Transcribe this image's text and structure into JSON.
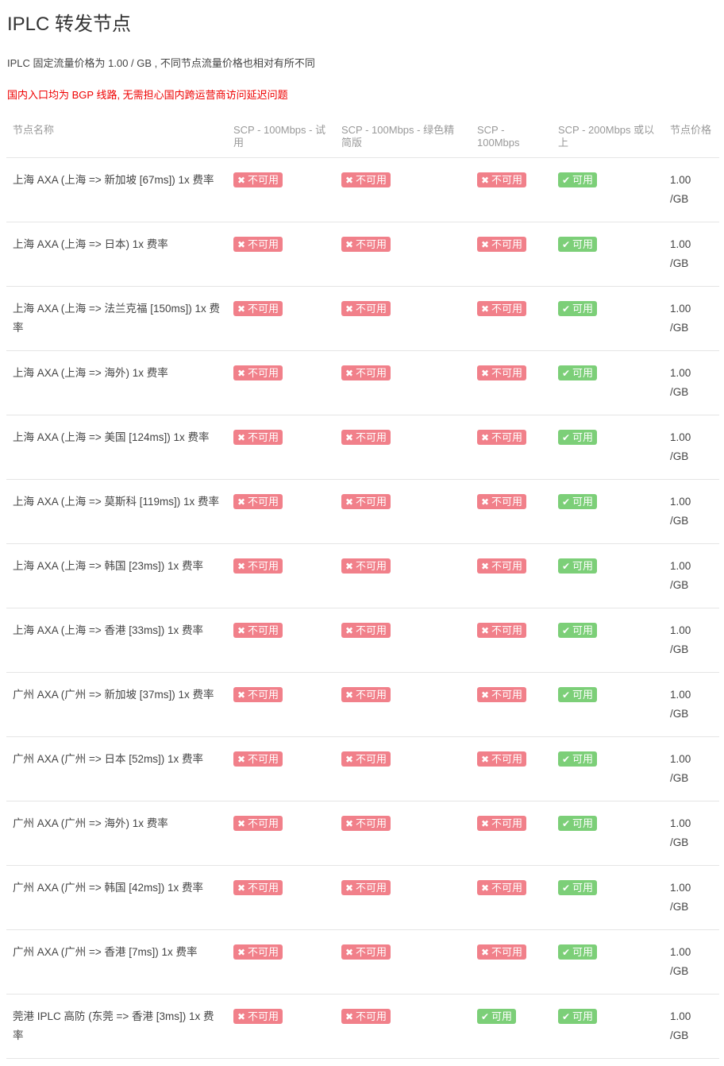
{
  "title": "IPLC 转发节点",
  "description": "IPLC 固定流量价格为 1.00 / GB , 不同节点流量价格也相对有所不同",
  "notice": "国内入口均为 BGP 线路, 无需担心国内跨运营商访问延迟问题",
  "colors": {
    "unavailable": "#f1808a",
    "available": "#7ccf78",
    "notice": "#ee0000"
  },
  "icons": {
    "unavailable": "close-icon",
    "available": "check-icon"
  },
  "status_labels": {
    "no": "不可用",
    "yes": "可用"
  },
  "columns": [
    "节点名称",
    "SCP - 100Mbps - 试用",
    "SCP - 100Mbps - 绿色精简版",
    "SCP - 100Mbps",
    "SCP - 200Mbps 或以上",
    "节点价格"
  ],
  "rows": [
    {
      "name": "上海 AXA (上海 => 新加坡 [67ms]) 1x 费率",
      "status": [
        "no",
        "no",
        "no",
        "yes"
      ],
      "price": "1.00",
      "unit": "/GB"
    },
    {
      "name": "上海 AXA (上海 => 日本) 1x 费率",
      "status": [
        "no",
        "no",
        "no",
        "yes"
      ],
      "price": "1.00",
      "unit": "/GB"
    },
    {
      "name": "上海 AXA (上海 => 法兰克福 [150ms]) 1x 费率",
      "status": [
        "no",
        "no",
        "no",
        "yes"
      ],
      "price": "1.00",
      "unit": "/GB"
    },
    {
      "name": "上海 AXA (上海 => 海外) 1x 费率",
      "status": [
        "no",
        "no",
        "no",
        "yes"
      ],
      "price": "1.00",
      "unit": "/GB"
    },
    {
      "name": "上海 AXA (上海 => 美国 [124ms]) 1x 费率",
      "status": [
        "no",
        "no",
        "no",
        "yes"
      ],
      "price": "1.00",
      "unit": "/GB"
    },
    {
      "name": "上海 AXA (上海 => 莫斯科 [119ms]) 1x 费率",
      "status": [
        "no",
        "no",
        "no",
        "yes"
      ],
      "price": "1.00",
      "unit": "/GB"
    },
    {
      "name": "上海 AXA (上海 => 韩国 [23ms]) 1x 费率",
      "status": [
        "no",
        "no",
        "no",
        "yes"
      ],
      "price": "1.00",
      "unit": "/GB"
    },
    {
      "name": "上海 AXA (上海 => 香港 [33ms]) 1x 费率",
      "status": [
        "no",
        "no",
        "no",
        "yes"
      ],
      "price": "1.00",
      "unit": "/GB"
    },
    {
      "name": "广州 AXA (广州 => 新加坡 [37ms]) 1x 费率",
      "status": [
        "no",
        "no",
        "no",
        "yes"
      ],
      "price": "1.00",
      "unit": "/GB"
    },
    {
      "name": "广州 AXA (广州 => 日本 [52ms]) 1x 费率",
      "status": [
        "no",
        "no",
        "no",
        "yes"
      ],
      "price": "1.00",
      "unit": "/GB"
    },
    {
      "name": "广州 AXA (广州 => 海外) 1x 费率",
      "status": [
        "no",
        "no",
        "no",
        "yes"
      ],
      "price": "1.00",
      "unit": "/GB"
    },
    {
      "name": "广州 AXA (广州 => 韩国 [42ms]) 1x 费率",
      "status": [
        "no",
        "no",
        "no",
        "yes"
      ],
      "price": "1.00",
      "unit": "/GB"
    },
    {
      "name": "广州 AXA (广州 => 香港 [7ms]) 1x 费率",
      "status": [
        "no",
        "no",
        "no",
        "yes"
      ],
      "price": "1.00",
      "unit": "/GB"
    },
    {
      "name": "莞港 IPLC 高防 (东莞 => 香港 [3ms]) 1x 费率",
      "status": [
        "no",
        "no",
        "yes",
        "yes"
      ],
      "price": "1.00",
      "unit": "/GB"
    }
  ]
}
